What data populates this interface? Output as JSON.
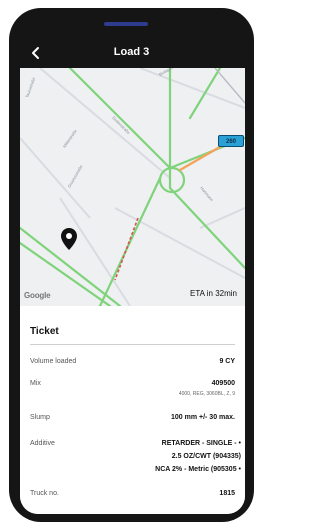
{
  "header": {
    "title": "Load 3"
  },
  "map": {
    "eta": "ETA in 32min",
    "google": "Google",
    "badge": "260",
    "streets": [
      "Taurustraße",
      "Dudenstraße",
      "Mittelstraße",
      "Budapesterstraße",
      "Hartmann",
      "Gropiusstraße"
    ]
  },
  "ticket": {
    "title": "Ticket",
    "rows": [
      {
        "label": "Volume loaded",
        "value": "9 CY"
      },
      {
        "label": "Mix",
        "value": "409500",
        "sub": "4000, REG, 3060BL, Z, 9"
      },
      {
        "label": "Slump",
        "value": "100 mm +/- 30 max."
      },
      {
        "label": "Additive",
        "lines": [
          "RETARDER - SINGLE - •",
          "2.5 OZ/CWT (904335)",
          "NCA 2% - Metric (905305 •"
        ]
      },
      {
        "label": "Truck no.",
        "value": "1815"
      }
    ]
  },
  "colors": {
    "frame": "#151515",
    "road_green": "#7fd37a",
    "road_orange": "#f4a35a",
    "road_red": "#d9534f",
    "badge": "#2aa1d6"
  }
}
